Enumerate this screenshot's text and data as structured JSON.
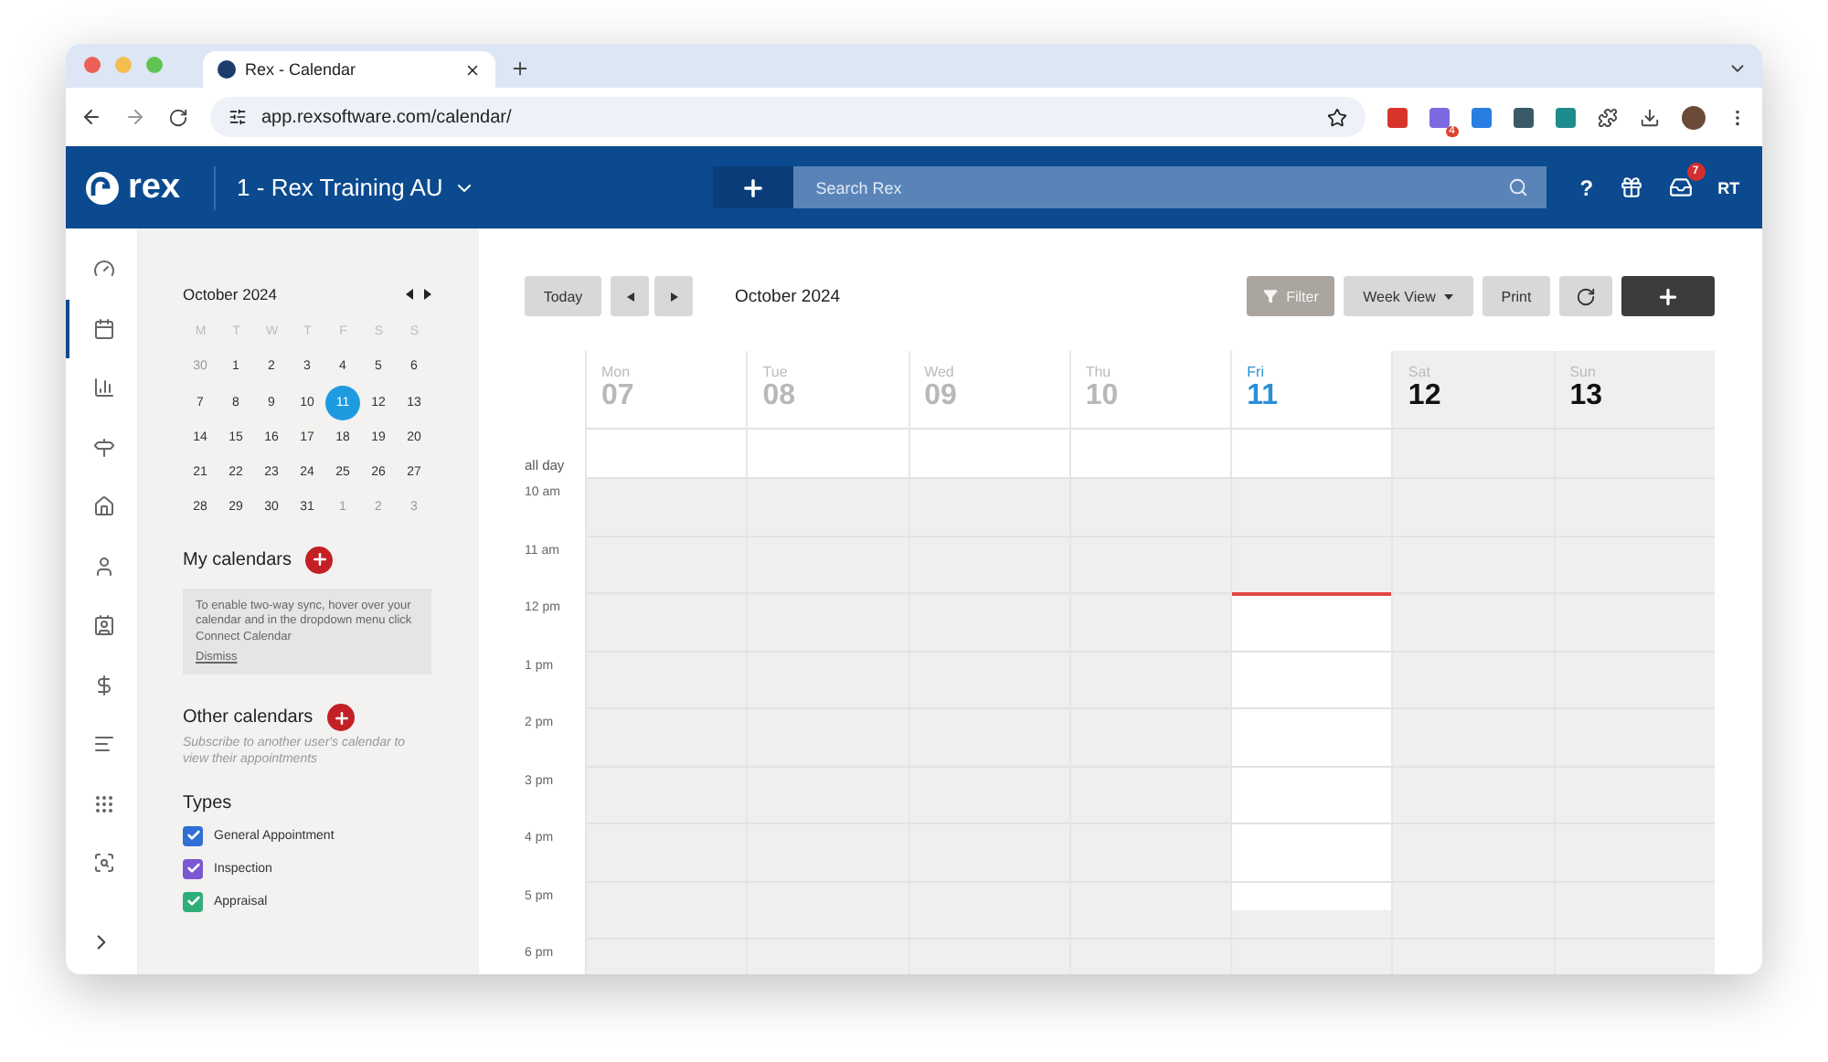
{
  "browser": {
    "tab_title": "Rex - Calendar",
    "url": "app.rexsoftware.com/calendar/",
    "extension_badge": "4"
  },
  "app_header": {
    "brand": "rex",
    "account": "1 - Rex Training AU",
    "search": {
      "placeholder": "Search Rex"
    },
    "help": "?",
    "notification_count": "7",
    "user_initials": "RT"
  },
  "nav_rail": [
    {
      "selected": false
    },
    {
      "selected": true
    },
    {
      "selected": false
    },
    {
      "selected": false
    },
    {
      "selected": false
    },
    {
      "selected": false
    },
    {
      "selected": false
    },
    {
      "selected": false
    },
    {
      "selected": false
    },
    {
      "selected": false
    },
    {
      "selected": false
    }
  ],
  "mini_calendar": {
    "title": "October 2024",
    "weekdays": [
      "M",
      "T",
      "W",
      "T",
      "F",
      "S",
      "S"
    ],
    "weeks": [
      [
        {
          "day": "30",
          "muted": true,
          "selected": false
        },
        {
          "day": "1",
          "muted": false,
          "selected": false
        },
        {
          "day": "2",
          "muted": false,
          "selected": false
        },
        {
          "day": "3",
          "muted": false,
          "selected": false
        },
        {
          "day": "4",
          "muted": false,
          "selected": false
        },
        {
          "day": "5",
          "muted": false,
          "selected": false
        },
        {
          "day": "6",
          "muted": false,
          "selected": false
        }
      ],
      [
        {
          "day": "7",
          "muted": false,
          "selected": false
        },
        {
          "day": "8",
          "muted": false,
          "selected": false
        },
        {
          "day": "9",
          "muted": false,
          "selected": false
        },
        {
          "day": "10",
          "muted": false,
          "selected": false
        },
        {
          "day": "11",
          "muted": false,
          "selected": true
        },
        {
          "day": "12",
          "muted": false,
          "selected": false
        },
        {
          "day": "13",
          "muted": false,
          "selected": false
        }
      ],
      [
        {
          "day": "14",
          "muted": false,
          "selected": false
        },
        {
          "day": "15",
          "muted": false,
          "selected": false
        },
        {
          "day": "16",
          "muted": false,
          "selected": false
        },
        {
          "day": "17",
          "muted": false,
          "selected": false
        },
        {
          "day": "18",
          "muted": false,
          "selected": false
        },
        {
          "day": "19",
          "muted": false,
          "selected": false
        },
        {
          "day": "20",
          "muted": false,
          "selected": false
        }
      ],
      [
        {
          "day": "21",
          "muted": false,
          "selected": false
        },
        {
          "day": "22",
          "muted": false,
          "selected": false
        },
        {
          "day": "23",
          "muted": false,
          "selected": false
        },
        {
          "day": "24",
          "muted": false,
          "selected": false
        },
        {
          "day": "25",
          "muted": false,
          "selected": false
        },
        {
          "day": "26",
          "muted": false,
          "selected": false
        },
        {
          "day": "27",
          "muted": false,
          "selected": false
        }
      ],
      [
        {
          "day": "28",
          "muted": false,
          "selected": false
        },
        {
          "day": "29",
          "muted": false,
          "selected": false
        },
        {
          "day": "30",
          "muted": false,
          "selected": false
        },
        {
          "day": "31",
          "muted": false,
          "selected": false
        },
        {
          "day": "1",
          "muted": true,
          "selected": false
        },
        {
          "day": "2",
          "muted": true,
          "selected": false
        },
        {
          "day": "3",
          "muted": true,
          "selected": false
        }
      ]
    ]
  },
  "my_calendars": {
    "title": "My calendars",
    "notice": "To enable two-way sync, hover over your calendar and in the dropdown menu click Connect Calendar",
    "dismiss": "Dismiss"
  },
  "other_calendars": {
    "title": "Other calendars",
    "hint": "Subscribe to another user's calendar to view their appointments"
  },
  "types": {
    "title": "Types",
    "items": [
      {
        "label": "General Appointment",
        "checked": true,
        "color": "#2f6fd6"
      },
      {
        "label": "Inspection",
        "checked": true,
        "color": "#7b57d1"
      },
      {
        "label": "Appraisal",
        "checked": true,
        "color": "#2fae7a"
      }
    ]
  },
  "toolbar": {
    "today": "Today",
    "title": "October 2024",
    "filter": "Filter",
    "view": "Week View",
    "print": "Print"
  },
  "week": {
    "all_day": "all day",
    "days": [
      {
        "name": "Mon",
        "date": "07",
        "kind": "past"
      },
      {
        "name": "Tue",
        "date": "08",
        "kind": "past"
      },
      {
        "name": "Wed",
        "date": "09",
        "kind": "past"
      },
      {
        "name": "Thu",
        "date": "10",
        "kind": "past"
      },
      {
        "name": "Fri",
        "date": "11",
        "kind": "today"
      },
      {
        "name": "Sat",
        "date": "12",
        "kind": "weekend"
      },
      {
        "name": "Sun",
        "date": "13",
        "kind": "weekend"
      }
    ],
    "hours": [
      {
        "label": "10 am",
        "current": false
      },
      {
        "label": "11 am",
        "current": false
      },
      {
        "label": "12 pm",
        "current": true
      },
      {
        "label": "1 pm",
        "current": false
      },
      {
        "label": "2 pm",
        "current": false
      },
      {
        "label": "3 pm",
        "current": false
      },
      {
        "label": "4 pm",
        "current": false
      },
      {
        "label": "5 pm",
        "current": false
      },
      {
        "label": "6 pm",
        "current": false
      }
    ]
  }
}
